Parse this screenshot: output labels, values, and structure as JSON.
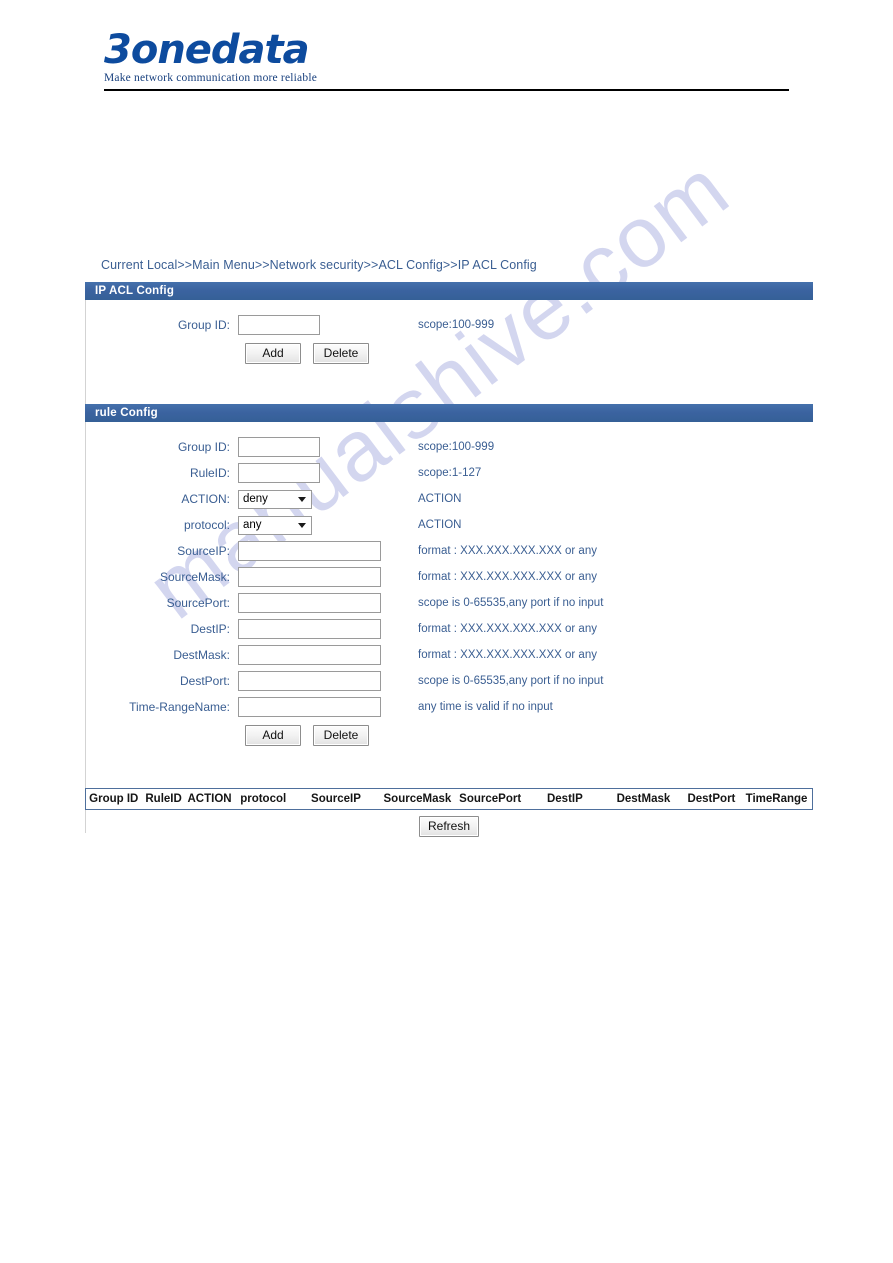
{
  "brand": {
    "name": "3onedata",
    "tagline": "Make network communication more reliable"
  },
  "watermark": "manualshive.com",
  "breadcrumb": "Current Local>>Main Menu>>Network security>>ACL Config>>IP ACL Config",
  "colors": {
    "section_bar": "#3b63a0",
    "label_text": "#3a5e92",
    "table_border": "#4e6f9c",
    "brand_blue": "#0d4b9e"
  },
  "acl_panel": {
    "title": "IP ACL Config",
    "fields": [
      {
        "label": "Group ID:",
        "value": "",
        "hint": "scope:100-999"
      }
    ],
    "buttons": {
      "add": "Add",
      "delete": "Delete"
    }
  },
  "rule_panel": {
    "title": "rule Config",
    "fields": [
      {
        "label": "Group ID:",
        "type": "text",
        "value": "",
        "hint": "scope:100-999"
      },
      {
        "label": "RuleID:",
        "type": "text",
        "value": "",
        "hint": "scope:1-127"
      },
      {
        "label": "ACTION:",
        "type": "select",
        "value": "deny",
        "hint": "ACTION"
      },
      {
        "label": "protocol:",
        "type": "select",
        "value": "any",
        "hint": "ACTION"
      },
      {
        "label": "SourceIP:",
        "type": "text",
        "value": "",
        "hint": "format : XXX.XXX.XXX.XXX or any"
      },
      {
        "label": "SourceMask:",
        "type": "text",
        "value": "",
        "hint": "format : XXX.XXX.XXX.XXX or any"
      },
      {
        "label": "SourcePort:",
        "type": "text",
        "value": "",
        "hint": "scope is 0-65535,any port if no input"
      },
      {
        "label": "DestIP:",
        "type": "text",
        "value": "",
        "hint": "format : XXX.XXX.XXX.XXX or any"
      },
      {
        "label": "DestMask:",
        "type": "text",
        "value": "",
        "hint": "format : XXX.XXX.XXX.XXX or any"
      },
      {
        "label": "DestPort:",
        "type": "text",
        "value": "",
        "hint": "scope is 0-65535,any port if no input"
      },
      {
        "label": "Time-RangeName:",
        "type": "text",
        "value": "",
        "hint": "any time is valid if no input"
      }
    ],
    "buttons": {
      "add": "Add",
      "delete": "Delete"
    }
  },
  "result_table": {
    "columns": [
      "Group ID",
      "RuleID",
      "ACTION",
      "protocol",
      "SourceIP",
      "SourceMask",
      "SourcePort",
      "DestIP",
      "DestMask",
      "DestPort",
      "TimeRange"
    ],
    "rows": [],
    "refresh_label": "Refresh"
  }
}
